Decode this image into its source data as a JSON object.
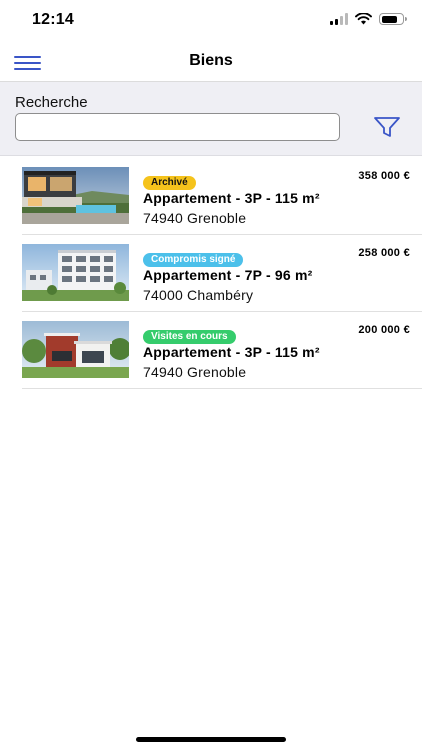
{
  "status_bar": {
    "time": "12:14"
  },
  "nav": {
    "title": "Biens"
  },
  "search": {
    "label": "Recherche",
    "value": "",
    "placeholder": ""
  },
  "colors": {
    "accent": "#3a55c7",
    "badge_archive": "#f5c31c",
    "badge_compromis": "#4cc0ea",
    "badge_visites": "#35cc6c"
  },
  "properties": [
    {
      "badge": "Archivé",
      "badge_type": "archive",
      "price": "358 000 €",
      "title": "Appartement - 3P - 115 m²",
      "location": "74940 Grenoble",
      "thumb": "modern-house-pool"
    },
    {
      "badge": "Compromis signé",
      "badge_type": "compromis",
      "price": "258 000 €",
      "title": "Appartement - 7P - 96 m²",
      "location": "74000 Chambéry",
      "thumb": "apartment-building"
    },
    {
      "badge": "Visites en cours",
      "badge_type": "visites",
      "price": "200 000 €",
      "title": "Appartement - 3P - 115 m²",
      "location": "74940 Grenoble",
      "thumb": "cube-house"
    }
  ]
}
